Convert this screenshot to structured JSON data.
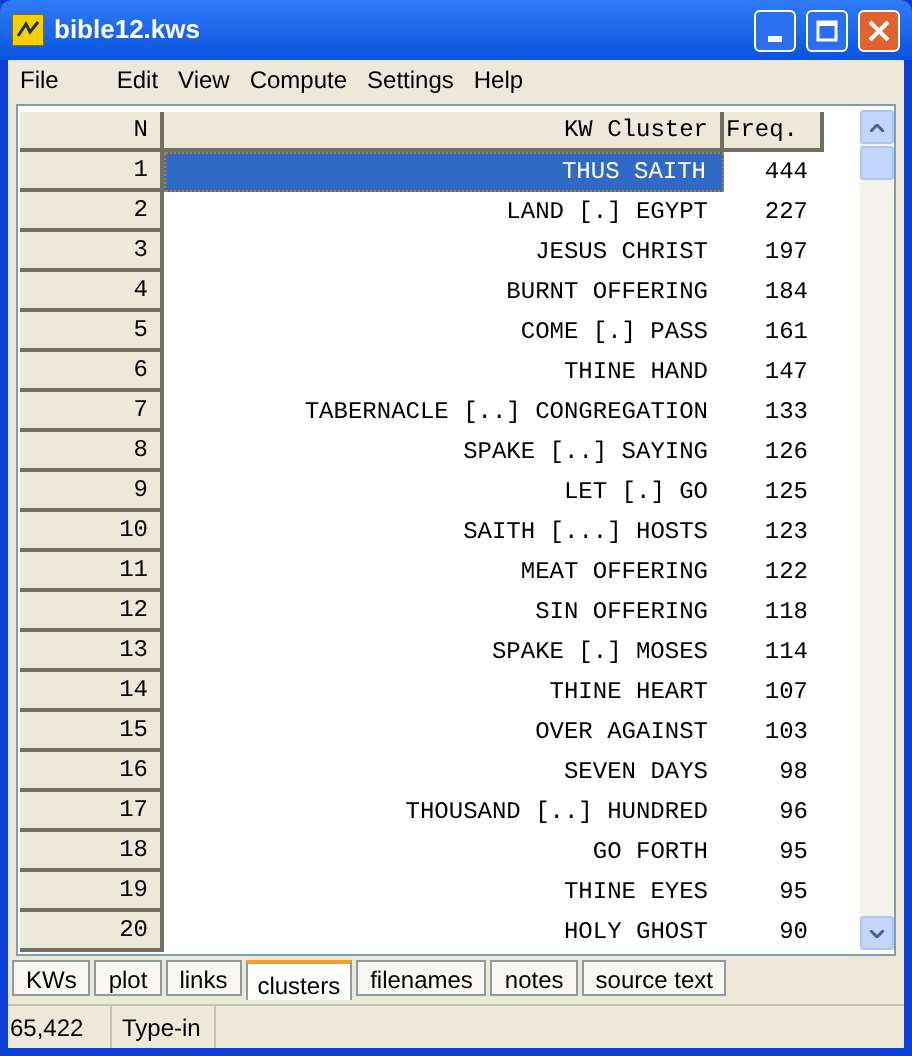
{
  "window": {
    "title": "bible12.kws"
  },
  "menu": [
    "File",
    "Edit",
    "View",
    "Compute",
    "Settings",
    "Help"
  ],
  "table": {
    "columns": [
      "N",
      "KW Cluster",
      "Freq."
    ],
    "rows": [
      {
        "n": "1",
        "cluster": "THUS SAITH",
        "freq": "444",
        "selected": true
      },
      {
        "n": "2",
        "cluster": "LAND [.] EGYPT",
        "freq": "227",
        "selected": false
      },
      {
        "n": "3",
        "cluster": "JESUS CHRIST",
        "freq": "197",
        "selected": false
      },
      {
        "n": "4",
        "cluster": "BURNT OFFERING",
        "freq": "184",
        "selected": false
      },
      {
        "n": "5",
        "cluster": "COME [.] PASS",
        "freq": "161",
        "selected": false
      },
      {
        "n": "6",
        "cluster": "THINE HAND",
        "freq": "147",
        "selected": false
      },
      {
        "n": "7",
        "cluster": "TABERNACLE [..] CONGREGATION",
        "freq": "133",
        "selected": false
      },
      {
        "n": "8",
        "cluster": "SPAKE [..] SAYING",
        "freq": "126",
        "selected": false
      },
      {
        "n": "9",
        "cluster": "LET [.] GO",
        "freq": "125",
        "selected": false
      },
      {
        "n": "10",
        "cluster": "SAITH [...] HOSTS",
        "freq": "123",
        "selected": false
      },
      {
        "n": "11",
        "cluster": "MEAT OFFERING",
        "freq": "122",
        "selected": false
      },
      {
        "n": "12",
        "cluster": "SIN OFFERING",
        "freq": "118",
        "selected": false
      },
      {
        "n": "13",
        "cluster": "SPAKE [.] MOSES",
        "freq": "114",
        "selected": false
      },
      {
        "n": "14",
        "cluster": "THINE HEART",
        "freq": "107",
        "selected": false
      },
      {
        "n": "15",
        "cluster": "OVER AGAINST",
        "freq": "103",
        "selected": false
      },
      {
        "n": "16",
        "cluster": "SEVEN DAYS",
        "freq": "98",
        "selected": false
      },
      {
        "n": "17",
        "cluster": "THOUSAND [..] HUNDRED",
        "freq": "96",
        "selected": false
      },
      {
        "n": "18",
        "cluster": "GO FORTH",
        "freq": "95",
        "selected": false
      },
      {
        "n": "19",
        "cluster": "THINE EYES",
        "freq": "95",
        "selected": false
      },
      {
        "n": "20",
        "cluster": "HOLY GHOST",
        "freq": "90",
        "selected": false
      }
    ]
  },
  "tabs": [
    {
      "label": "KWs",
      "selected": false
    },
    {
      "label": "plot",
      "selected": false
    },
    {
      "label": "links",
      "selected": false
    },
    {
      "label": "clusters",
      "selected": true
    },
    {
      "label": "filenames",
      "selected": false
    },
    {
      "label": "notes",
      "selected": false
    },
    {
      "label": "source text",
      "selected": false
    }
  ],
  "status_bar": [
    "65,422",
    "Type-in"
  ]
}
